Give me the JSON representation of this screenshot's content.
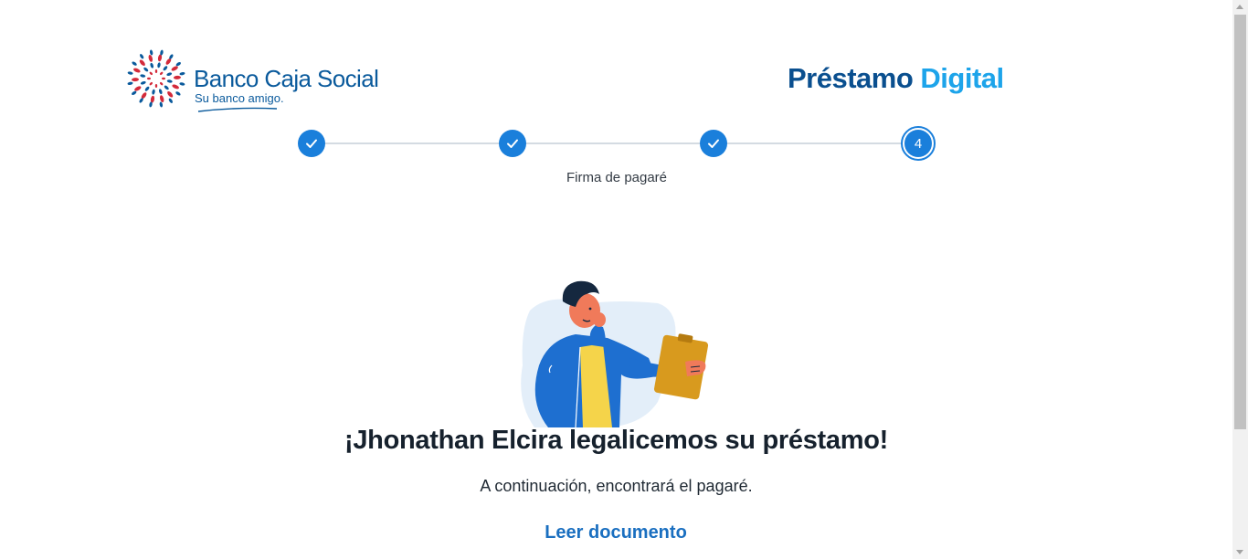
{
  "brand": {
    "name": "Banco Caja Social",
    "tagline": "Su banco amigo.",
    "colors": {
      "primary": "#0a5a9c",
      "accent": "#1da4ea",
      "red": "#d32a3a"
    }
  },
  "product": {
    "title_main": "Préstamo",
    "title_accent": "Digital"
  },
  "stepper": {
    "steps": [
      {
        "state": "completed",
        "icon": "check-icon"
      },
      {
        "state": "completed",
        "icon": "check-icon"
      },
      {
        "state": "completed",
        "icon": "check-icon"
      },
      {
        "state": "current",
        "number": "4"
      }
    ],
    "current_label": "Firma de pagaré"
  },
  "illustration": {
    "subject": "person-thinking-with-clipboard"
  },
  "content": {
    "headline": "¡Jhonathan Elcira legalicemos su préstamo!",
    "subtext": "A continuación, encontrará el pagaré.",
    "link_label": "Leer documento"
  }
}
